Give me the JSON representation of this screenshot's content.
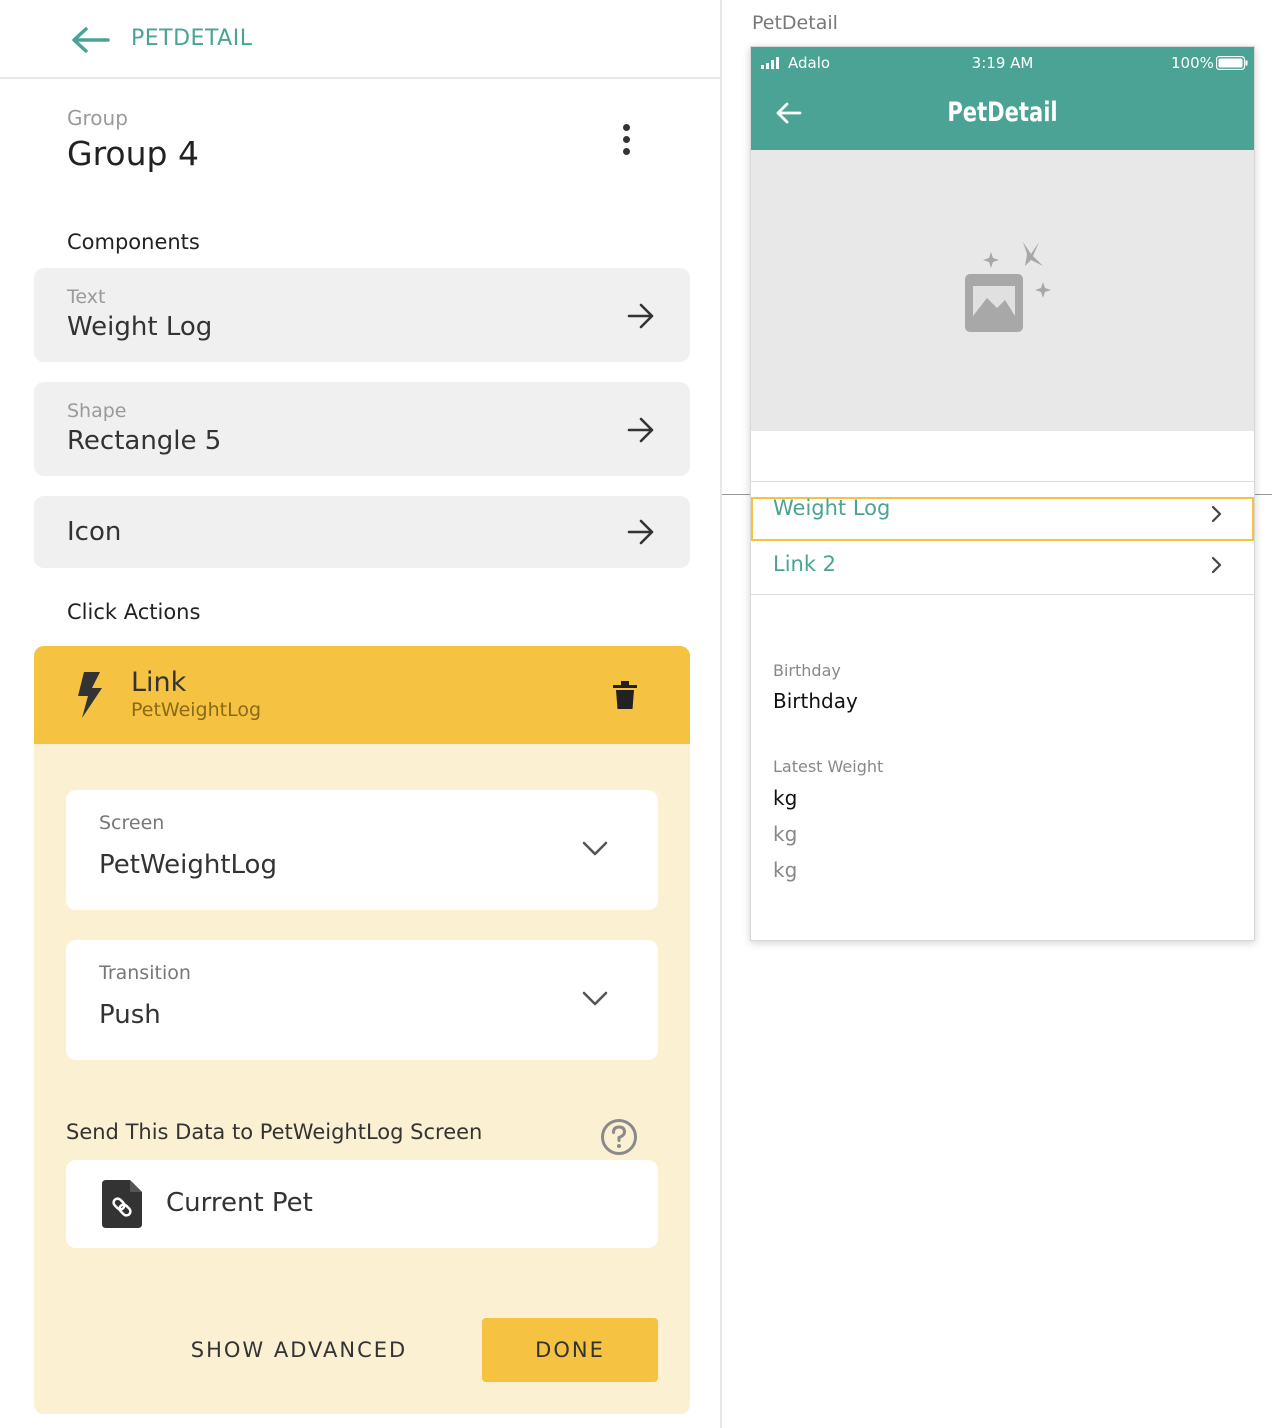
{
  "nav": {
    "title": "PETDETAIL"
  },
  "group": {
    "type_label": "Group",
    "name": "Group 4"
  },
  "components": {
    "heading": "Components",
    "items": [
      {
        "type": "Text",
        "name": "Weight Log"
      },
      {
        "type": "Shape",
        "name": "Rectangle 5"
      },
      {
        "type": "",
        "name": "Icon"
      }
    ]
  },
  "click_actions": {
    "heading": "Click Actions",
    "action": {
      "title": "Link",
      "subtitle": "PetWeightLog",
      "screen_label": "Screen",
      "screen_value": "PetWeightLog",
      "transition_label": "Transition",
      "transition_value": "Push",
      "send_heading": "Send This Data to PetWeightLog Screen",
      "data_value": "Current Pet",
      "show_advanced": "SHOW ADVANCED",
      "done": "DONE"
    }
  },
  "preview": {
    "canvas_label": "PetDetail",
    "status": {
      "carrier": "Adalo",
      "time": "3:19 AM",
      "battery": "100%"
    },
    "title": "PetDetail",
    "links": [
      "Weight Log",
      "Link 2"
    ],
    "birthday_label": "Birthday",
    "birthday_value": "Birthday",
    "weight_label": "Latest Weight",
    "weights": [
      "kg",
      "kg",
      "kg"
    ]
  },
  "colors": {
    "accent": "#4aa394",
    "action_yellow": "#f5c242",
    "action_bg": "#fcf0d3"
  }
}
